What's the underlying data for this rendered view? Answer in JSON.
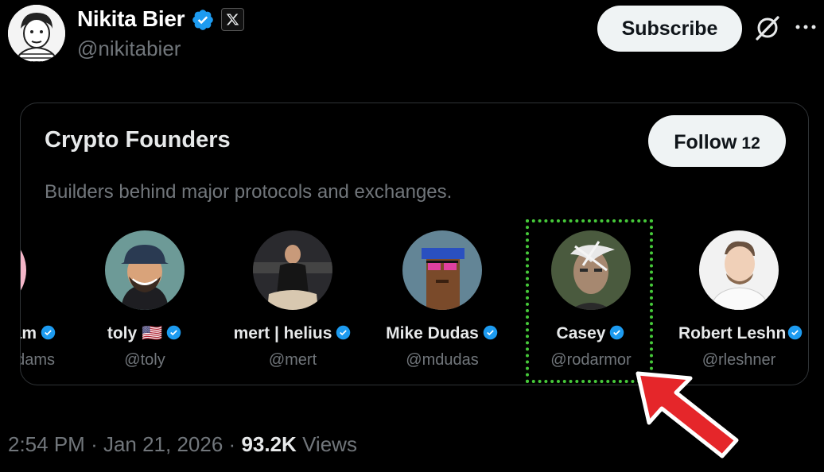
{
  "author": {
    "name": "Nikita Bier",
    "handle": "@nikitabier"
  },
  "header": {
    "subscribe_label": "Subscribe"
  },
  "list_card": {
    "title": "Crypto Founders",
    "follow_label": "Follow",
    "follow_count": "12",
    "description": "Builders behind major protocols and exchanges.",
    "members": [
      {
        "name": "am",
        "handle": "dams"
      },
      {
        "name": "toly",
        "flag": "🇺🇸",
        "handle": "@toly"
      },
      {
        "name": "mert | helius",
        "handle": "@mert"
      },
      {
        "name": "Mike Dudas",
        "handle": "@mdudas"
      },
      {
        "name": "Casey",
        "handle": "@rodarmor"
      },
      {
        "name": "Robert Leshn",
        "handle": "@rleshner"
      }
    ]
  },
  "footer": {
    "time": "2:54 PM",
    "date": "Jan 21, 2026",
    "views_count": "93.2K",
    "views_label": "Views"
  },
  "colors": {
    "background": "#000000",
    "verified_blue": "#1d9bf0",
    "highlight_green": "#46c93a",
    "arrow_red": "#e5262a",
    "muted_text": "#71767b"
  },
  "icons": [
    "verified-badge-icon",
    "x-logo-icon",
    "grok-icon",
    "more-icon",
    "red-arrow-annotation"
  ]
}
